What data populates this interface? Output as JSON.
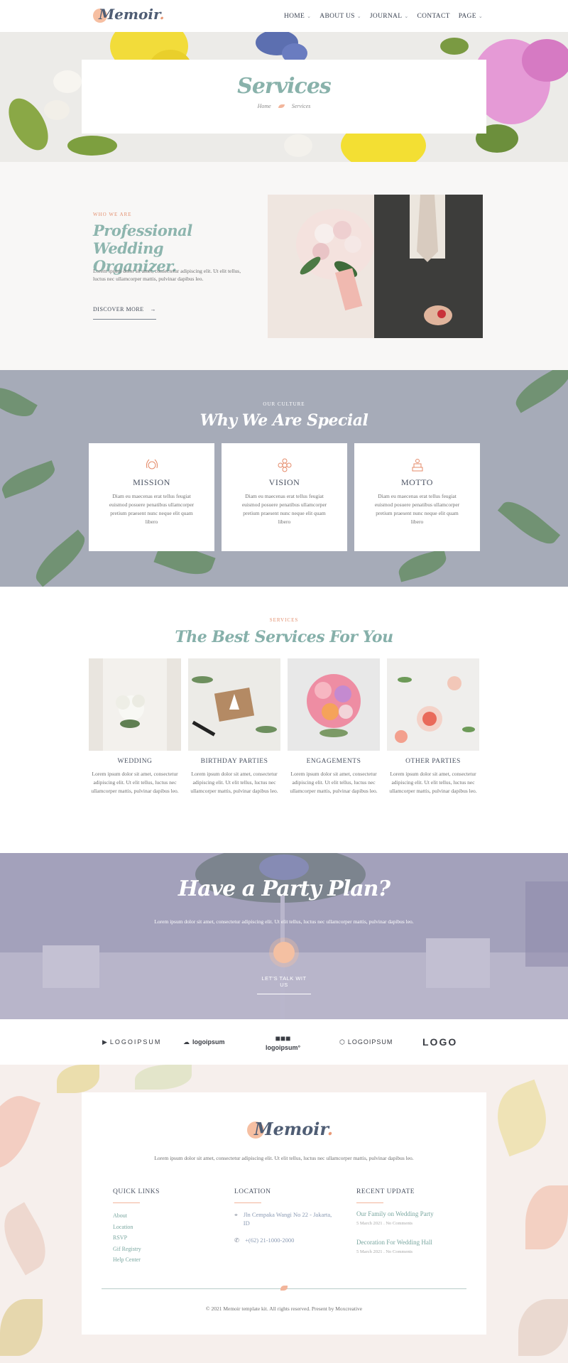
{
  "brand": {
    "name": "Memoir",
    "dot": "."
  },
  "nav": [
    {
      "label": "HOME",
      "dropdown": true
    },
    {
      "label": "ABOUT US",
      "dropdown": true
    },
    {
      "label": "JOURNAL",
      "dropdown": true
    },
    {
      "label": "CONTACT",
      "dropdown": false
    },
    {
      "label": "PAGE",
      "dropdown": true
    }
  ],
  "hero": {
    "title": "Services",
    "breadcrumb_home": "Home",
    "breadcrumb_current": "Services"
  },
  "about": {
    "eyebrow": "WHO WE ARE",
    "title": "Professional Wedding Organizer.",
    "text": "Lorem ipsum dolor sit amet, consectetur adipiscing elit. Ut elit tellus, luctus nec ullamcorper mattis, pulvinar dapibus leo.",
    "button": "DISCOVER MORE",
    "arrow": "→"
  },
  "why": {
    "eyebrow": "OUR CULTURE",
    "title": "Why We Are Special",
    "cards": [
      {
        "title": "MISSION",
        "icon": "laurel-icon",
        "text": "Diam eu maecenas erat tellus feugiat euismod posuere penatibus ullamcorper pretium praesent nunc neque elit quam libero"
      },
      {
        "title": "VISION",
        "icon": "flower-icon",
        "text": "Diam eu maecenas erat tellus feugiat euismod posuere penatibus ullamcorper pretium praesent nunc neque elit quam libero"
      },
      {
        "title": "MOTTO",
        "icon": "cake-icon",
        "text": "Diam eu maecenas erat tellus feugiat euismod posuere penatibus ullamcorper pretium praesent nunc neque elit quam libero"
      }
    ]
  },
  "services": {
    "eyebrow": "SERVICES",
    "title": "The Best Services For You",
    "items": [
      {
        "name": "WEDDING",
        "text": "Lorem ipsum dolor sit amet, consectetur adipiscing elit. Ut elit tellus, luctus nec ullamcorper mattis, pulvinar dapibus leo."
      },
      {
        "name": "BIRTHDAY PARTIES",
        "text": "Lorem ipsum dolor sit amet, consectetur adipiscing elit. Ut elit tellus, luctus nec ullamcorper mattis, pulvinar dapibus leo."
      },
      {
        "name": "ENGAGEMENTS",
        "text": "Lorem ipsum dolor sit amet, consectetur adipiscing elit. Ut elit tellus, luctus nec ullamcorper mattis, pulvinar dapibus leo."
      },
      {
        "name": "OTHER PARTIES",
        "text": "Lorem ipsum dolor sit amet, consectetur adipiscing elit. Ut elit tellus, luctus nec ullamcorper mattis, pulvinar dapibus leo."
      }
    ]
  },
  "cta": {
    "title": "Have a Party Plan?",
    "text": "Lorem ipsum dolor sit amet, consectetur adipiscing elit. Ut elit tellus, luctus nec ullamcorper mattis, pulvinar dapibus leo.",
    "link": "LET'S TALK WIT US"
  },
  "client_logos": [
    "LOGOIPSUM",
    "logoipsum",
    "logoipsum°",
    "LOGOIPSUM",
    "LOGO"
  ],
  "footer": {
    "description": "Lorem ipsum dolor sit amet, consectetur adipiscing elit. Ut elit tellus, luctus nec ullamcorper mattis, pulvinar dapibus leo.",
    "quick_links_title": "QUICK LINKS",
    "quick_links": [
      "About",
      "Location",
      "RSVP",
      "Gif Registry",
      "Help Center"
    ],
    "location_title": "LOCATION",
    "address": "Jln Cempaka Wangi No 22 - Jakarta, ID",
    "phone": "+(62) 21-1000-2000",
    "recent_title": "RECENT UPDATE",
    "posts": [
      {
        "title": "Our Family on Wedding Party",
        "meta": "5 March 2021 . No Comments"
      },
      {
        "title": "Decoration For Wedding Hall",
        "meta": "5 March 2021 . No Comments"
      }
    ],
    "copyright": "© 2021 Memoir template kit. All rights reserved. Present by Moxcreative"
  },
  "colors": {
    "accent": "#8db5ae",
    "peach": "#f6bfa2",
    "eyebrow": "#e39171",
    "navy": "#4f5d74"
  }
}
